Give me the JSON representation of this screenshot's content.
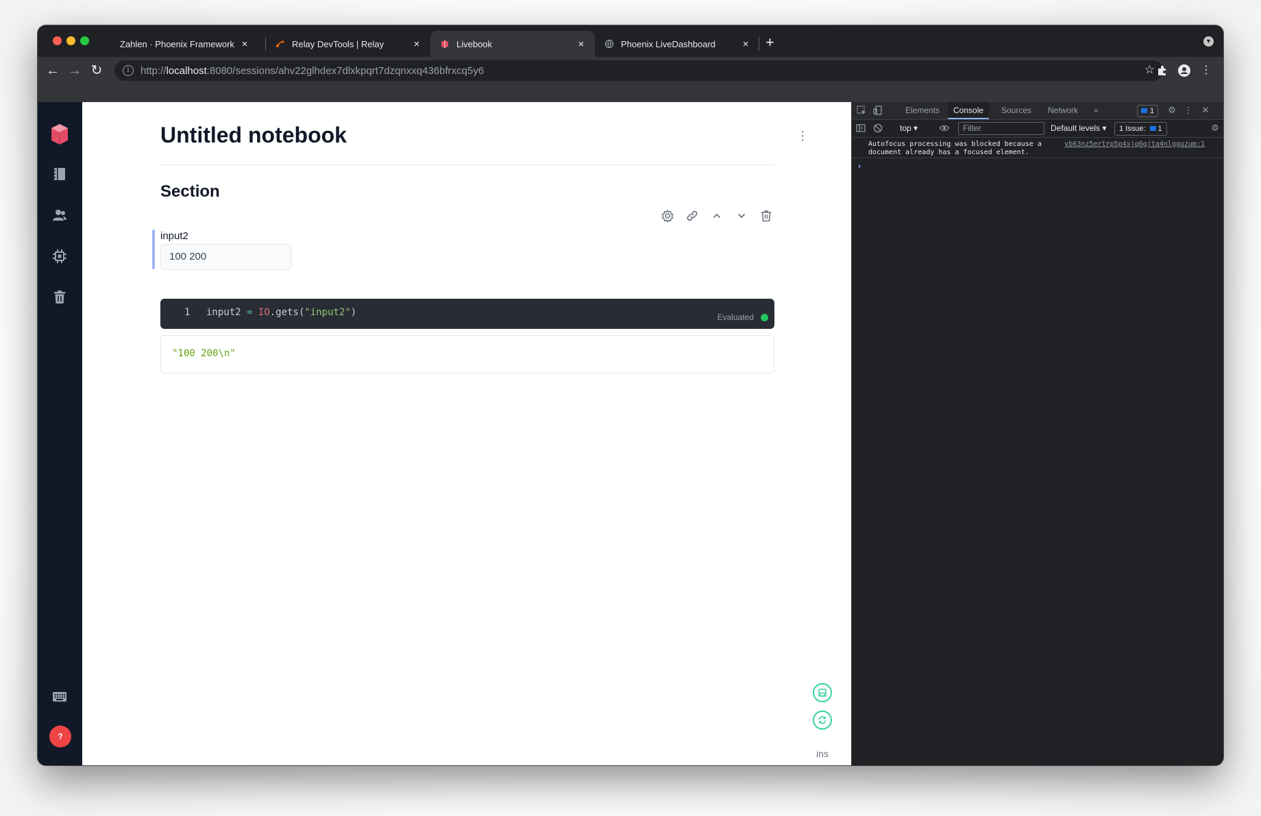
{
  "browser": {
    "tabs": [
      {
        "title": "Zahlen · Phoenix Framework",
        "active": false
      },
      {
        "title": "Relay DevTools | Relay",
        "active": false
      },
      {
        "title": "Livebook",
        "active": true
      },
      {
        "title": "Phoenix LiveDashboard",
        "active": false
      }
    ],
    "tab_close": "×",
    "new_tab": "+",
    "url_scheme": "http://",
    "url_host": "localhost",
    "url_rest": ":8080/sessions/ahv22glhdex7dlxkpqrt7dzqnxxq436bfrxcq5y6"
  },
  "notebook": {
    "title": "Untitled notebook",
    "section_title": "Section",
    "input_cell": {
      "label": "input2",
      "value": "100 200"
    },
    "code_cell": {
      "line_number": "1",
      "code_tokens": {
        "var": "input2",
        "op": " = ",
        "module": "IO",
        "call": ".gets(",
        "arg": "\"input2\"",
        "close": ")"
      },
      "status": "Evaluated"
    },
    "output": "\"100 200\\n\"",
    "float_label": "ins"
  },
  "devtools": {
    "tabs": [
      "Elements",
      "Console",
      "Sources",
      "Network"
    ],
    "active_tab": "Console",
    "more_tabs": "»",
    "message_count": "1",
    "context": "top ▾",
    "filter_placeholder": "Filter",
    "levels": "Default levels ▾",
    "issues_label": "1 Issue:",
    "issues_count": "1",
    "console_message": "Autofocus processing was blocked because a document already has a focused element.",
    "console_source": "vb63nz5ertrp5p4xjq6gjta4nlgguzum:1",
    "prompt": "›"
  },
  "colors": {
    "sidebar_bg": "#111827",
    "accent_green": "#34d399",
    "status_green": "#22c55e",
    "help_red": "#ef4444",
    "input_bar": "#a5b4fc"
  }
}
